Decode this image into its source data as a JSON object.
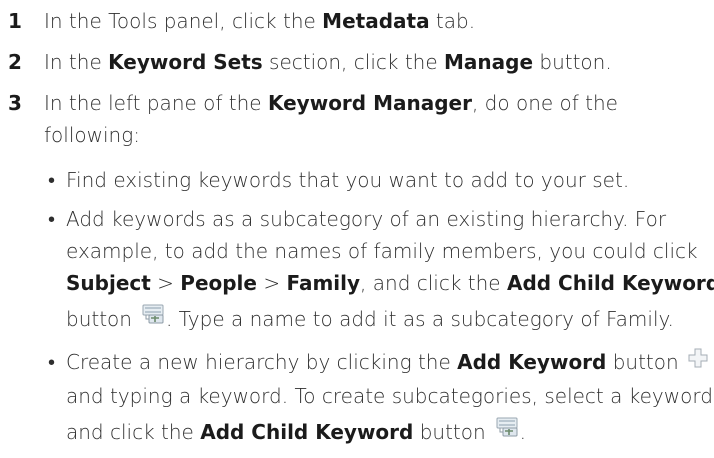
{
  "steps": [
    {
      "number": "1",
      "pre": "In the Tools panel, click the ",
      "b1": "Metadata",
      "post": " tab."
    },
    {
      "number": "2",
      "pre": "In the ",
      "b1": "Keyword Sets",
      "mid": " section, click the ",
      "b2": "Manage",
      "post": " button."
    },
    {
      "number": "3",
      "line1_pre": "In the left pane of the ",
      "line1_b": "Keyword Manager",
      "line1_post": ", do one of the",
      "line2": "following:"
    }
  ],
  "bullets": [
    {
      "text": "Find existing keywords that you want to add to your set."
    },
    {
      "line1": "Add keywords as a subcategory of an existing hierarchy. For",
      "line2": "example, to add the names of family members, you could click",
      "line3_b1": "Subject",
      "line3_sep1": " > ",
      "line3_b2": "People",
      "line3_sep2": " > ",
      "line3_b3": "Family",
      "line3_mid": ", and click the ",
      "line3_b4": "Add Child Keyword",
      "line4_pre": "button",
      "line4_post": ". Type a name to add it as a subcategory of Family."
    },
    {
      "line1_pre": "Create a new hierarchy by clicking the ",
      "line1_b": "Add Keyword",
      "line1_post": " button",
      "line2": "and typing a keyword. To create subcategories, select a keyword",
      "line3_pre": "and click the ",
      "line3_b": "Add Child Keyword",
      "line3_post": " button",
      "line3_end": "."
    }
  ],
  "bullet_char": "•",
  "icons": {
    "add_child": "add-child-keyword-icon",
    "add_keyword": "add-keyword-icon"
  }
}
